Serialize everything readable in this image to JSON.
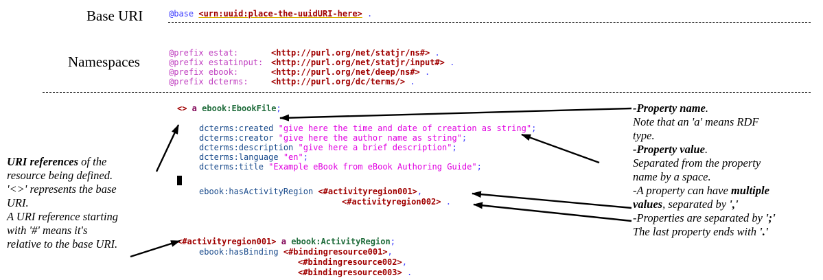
{
  "labels": {
    "base_uri": "Base URI",
    "namespaces": "Namespaces"
  },
  "code": {
    "base": {
      "keyword": "@base",
      "iri": "<urn:uuid:place-the-uuidURI-here>",
      "end": " ."
    },
    "prefixes": [
      {
        "keyword": "@prefix",
        "name": "estat:",
        "iri": "<http://purl.org/net/statjr/ns#>",
        "end": " ."
      },
      {
        "keyword": "@prefix",
        "name": "estatinput:",
        "iri": "<http://purl.org/net/statjr/input#>",
        "end": " ."
      },
      {
        "keyword": "@prefix",
        "name": "ebook:",
        "iri": "<http://purl.org/net/deep/ns#>",
        "end": " ."
      },
      {
        "keyword": "@prefix",
        "name": "dcterms:",
        "iri": "<http://purl.org/dc/terms/>",
        "end": " ."
      }
    ],
    "resource": {
      "subject": "<>",
      "a": " a ",
      "type": "ebook:EbookFile",
      "semi": ";"
    },
    "properties": [
      {
        "name": "dcterms:created",
        "value": " \"give here the time and date of creation as string\"",
        "end": ";"
      },
      {
        "name": "dcterms:creator",
        "value": " \"give here the author name as string\"",
        "end": ";"
      },
      {
        "name": "dcterms:description",
        "value": " \"give here a brief description\"",
        "end": ";"
      },
      {
        "name": "dcterms:language",
        "value": " \"en\"",
        "end": ";"
      },
      {
        "name": "dcterms:title",
        "value": " \"Example eBook from eBook Authoring Guide\"",
        "end": ";"
      }
    ],
    "has_activity": {
      "name": "ebook:hasActivityRegion",
      "value1": " <#activityregion001>",
      "sep1": ",",
      "value2": "<#activityregion002>",
      "end": " ."
    },
    "activity_region": {
      "subject": "<#activityregion001>",
      "a": " a ",
      "type": "ebook:ActivityRegion",
      "semi": ";",
      "binding_name": "ebook:hasBinding",
      "bindings": [
        "<#bindingresource001>",
        "<#bindingresource002>",
        "<#bindingresource003>"
      ],
      "binding_seps": [
        ",",
        ",",
        " ."
      ]
    }
  },
  "notes": {
    "left": {
      "l1_bold": "URI references",
      "l1_rest": " of the",
      "l2": "resource being defined.",
      "l3": "'<>' represents the base",
      "l4": "URI.",
      "l5": "A URI reference starting",
      "l6": "with '#' means it's",
      "l7": "relative to the base URI."
    },
    "right": {
      "p1_bold": "-Property name",
      "p1_end": ".",
      "p2": "Note that an 'a' means RDF",
      "p3": "type.",
      "p4_bold": "-Property value",
      "p4_end": ".",
      "p5": "Separated from the property",
      "p6": "name by a space.",
      "p7_pre": "-A property can have ",
      "p7_bold": "multiple",
      "p8_bold": "values",
      "p8_rest": ", separated by ",
      "p8_q": "','",
      "p9_pre": "-Properties are separated by ",
      "p9_q": "';'",
      "p10_pre": "The last property ends with ",
      "p10_q": "'.'"
    }
  }
}
